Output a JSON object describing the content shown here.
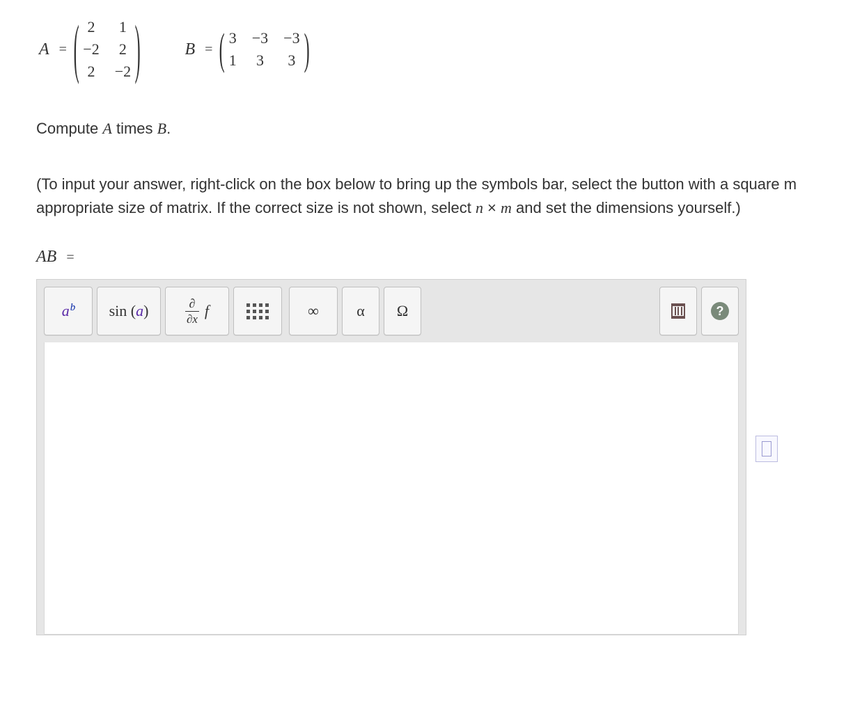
{
  "matrices": {
    "A": {
      "label": "A",
      "eq": "=",
      "rows": [
        [
          "2",
          "1"
        ],
        [
          "−2",
          "2"
        ],
        [
          "2",
          "−2"
        ]
      ]
    },
    "B": {
      "label": "B",
      "eq": "=",
      "rows": [
        [
          "3",
          "−3",
          "−3"
        ],
        [
          "1",
          "3",
          "3"
        ]
      ]
    }
  },
  "prompt": {
    "pre": "Compute ",
    "A": "A",
    "mid": " times ",
    "B": "B",
    "post": "."
  },
  "instructions": {
    "line1_pre": "(To input your answer, right-click on the box below to bring up the symbols bar, select the button with a square m",
    "line2_pre": "appropriate size of matrix. If the correct size is not shown, select ",
    "n": "n",
    "times": " × ",
    "m": "m",
    "line2_post": " and set the dimensions yourself.)"
  },
  "answer_label": {
    "AB": "AB",
    "eq": "="
  },
  "toolbar": {
    "ab": {
      "base": "a",
      "sup": "b"
    },
    "sin": {
      "fn": "sin",
      "open": "(",
      "arg": "a",
      "close": ")"
    },
    "ddx": {
      "num": "∂",
      "den": "∂x",
      "f": "f"
    },
    "infinity": "∞",
    "alpha": "α",
    "omega": "Ω",
    "help": "?"
  }
}
